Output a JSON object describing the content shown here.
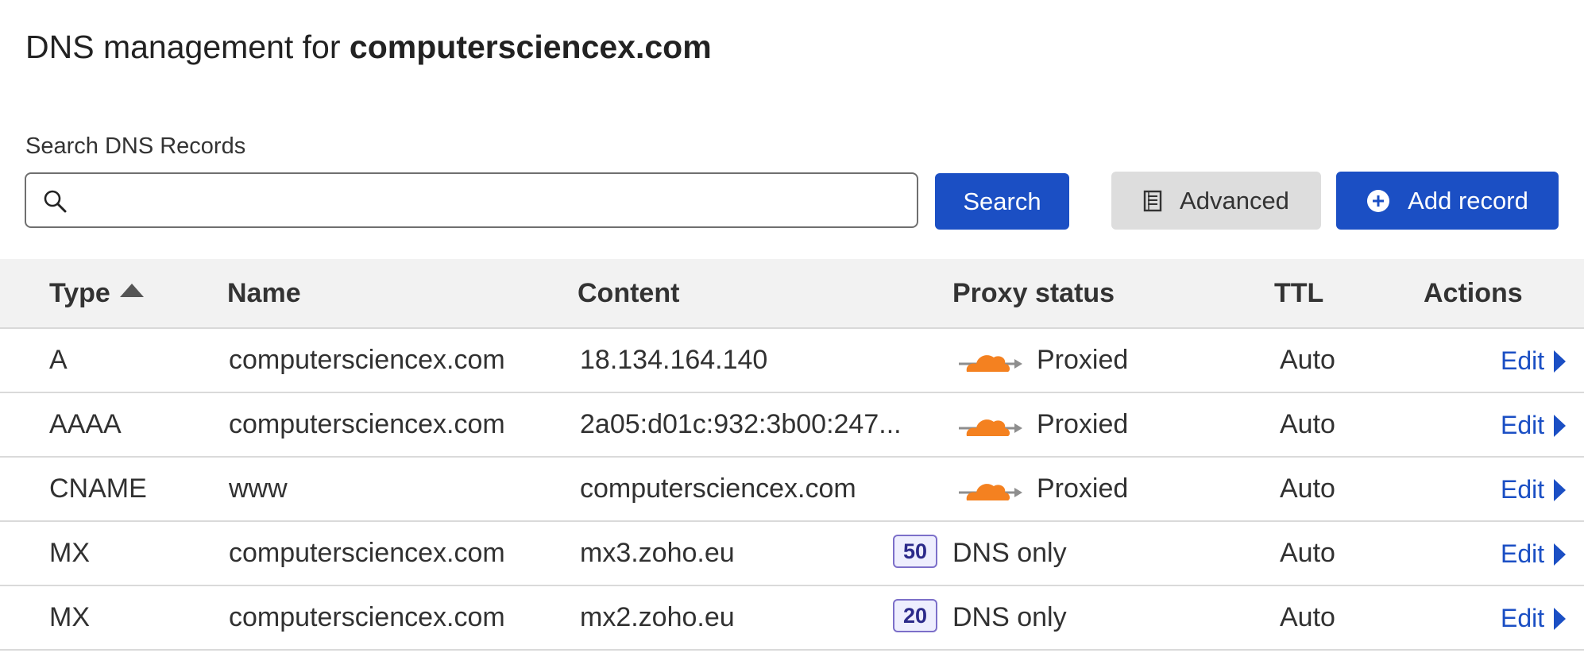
{
  "header": {
    "title_prefix": "DNS management for",
    "domain": "computersciencex.com"
  },
  "search": {
    "label": "Search DNS Records",
    "value": "",
    "placeholder": "",
    "search_button": "Search",
    "advanced_button": "Advanced",
    "add_button": "Add record"
  },
  "table": {
    "columns": {
      "type": "Type",
      "name": "Name",
      "content": "Content",
      "proxy": "Proxy status",
      "ttl": "TTL",
      "actions": "Actions"
    },
    "sort": {
      "column": "Type",
      "direction": "ascending"
    },
    "rows": [
      {
        "type": "A",
        "name": "computersciencex.com",
        "content": "18.134.164.140",
        "proxy": "Proxied",
        "priority": "",
        "ttl": "Auto",
        "action": "Edit"
      },
      {
        "type": "AAAA",
        "name": "computersciencex.com",
        "content": "2a05:d01c:932:3b00:247...",
        "proxy": "Proxied",
        "priority": "",
        "ttl": "Auto",
        "action": "Edit"
      },
      {
        "type": "CNAME",
        "name": "www",
        "content": "computersciencex.com",
        "proxy": "Proxied",
        "priority": "",
        "ttl": "Auto",
        "action": "Edit"
      },
      {
        "type": "MX",
        "name": "computersciencex.com",
        "content": "mx3.zoho.eu",
        "proxy": "DNS only",
        "priority": "50",
        "ttl": "Auto",
        "action": "Edit"
      },
      {
        "type": "MX",
        "name": "computersciencex.com",
        "content": "mx2.zoho.eu",
        "proxy": "DNS only",
        "priority": "20",
        "ttl": "Auto",
        "action": "Edit"
      }
    ]
  },
  "icons": {
    "search": "search-icon",
    "advanced": "document-icon",
    "add": "plus-circle-icon",
    "proxied": "orange-cloud-icon",
    "edit": "caret-right-icon"
  },
  "colors": {
    "primary": "#1b4fc4",
    "cloud": "#f48120",
    "badge_border": "#7c6fc9",
    "header_bg": "#f2f2f2"
  }
}
